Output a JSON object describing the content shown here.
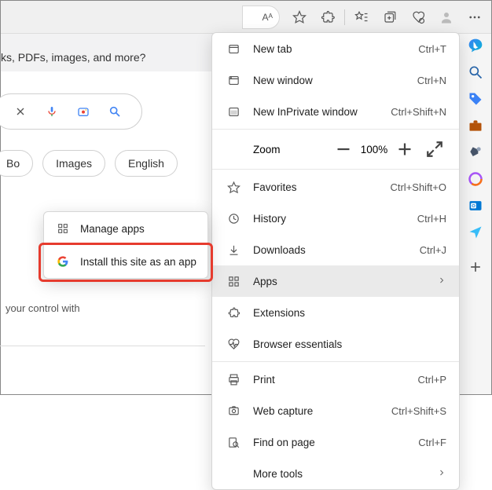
{
  "page": {
    "promo_text": "ks, PDFs, images, and more?",
    "chips": [
      "Bo",
      "Images",
      "English"
    ],
    "caption": "your control with"
  },
  "topbar": {
    "read_aloud": "Aᴬ"
  },
  "menu": {
    "new_tab": {
      "label": "New tab",
      "shortcut": "Ctrl+T"
    },
    "new_window": {
      "label": "New window",
      "shortcut": "Ctrl+N"
    },
    "new_inprivate": {
      "label": "New InPrivate window",
      "shortcut": "Ctrl+Shift+N"
    },
    "zoom": {
      "label": "Zoom",
      "value": "100%"
    },
    "favorites": {
      "label": "Favorites",
      "shortcut": "Ctrl+Shift+O"
    },
    "history": {
      "label": "History",
      "shortcut": "Ctrl+H"
    },
    "downloads": {
      "label": "Downloads",
      "shortcut": "Ctrl+J"
    },
    "apps": {
      "label": "Apps"
    },
    "extensions": {
      "label": "Extensions"
    },
    "browser_essentials": {
      "label": "Browser essentials"
    },
    "print": {
      "label": "Print",
      "shortcut": "Ctrl+P"
    },
    "web_capture": {
      "label": "Web capture",
      "shortcut": "Ctrl+Shift+S"
    },
    "find": {
      "label": "Find on page",
      "shortcut": "Ctrl+F"
    },
    "more_tools": {
      "label": "More tools"
    }
  },
  "submenu": {
    "manage_apps": "Manage apps",
    "install_app": "Install this site as an app"
  }
}
